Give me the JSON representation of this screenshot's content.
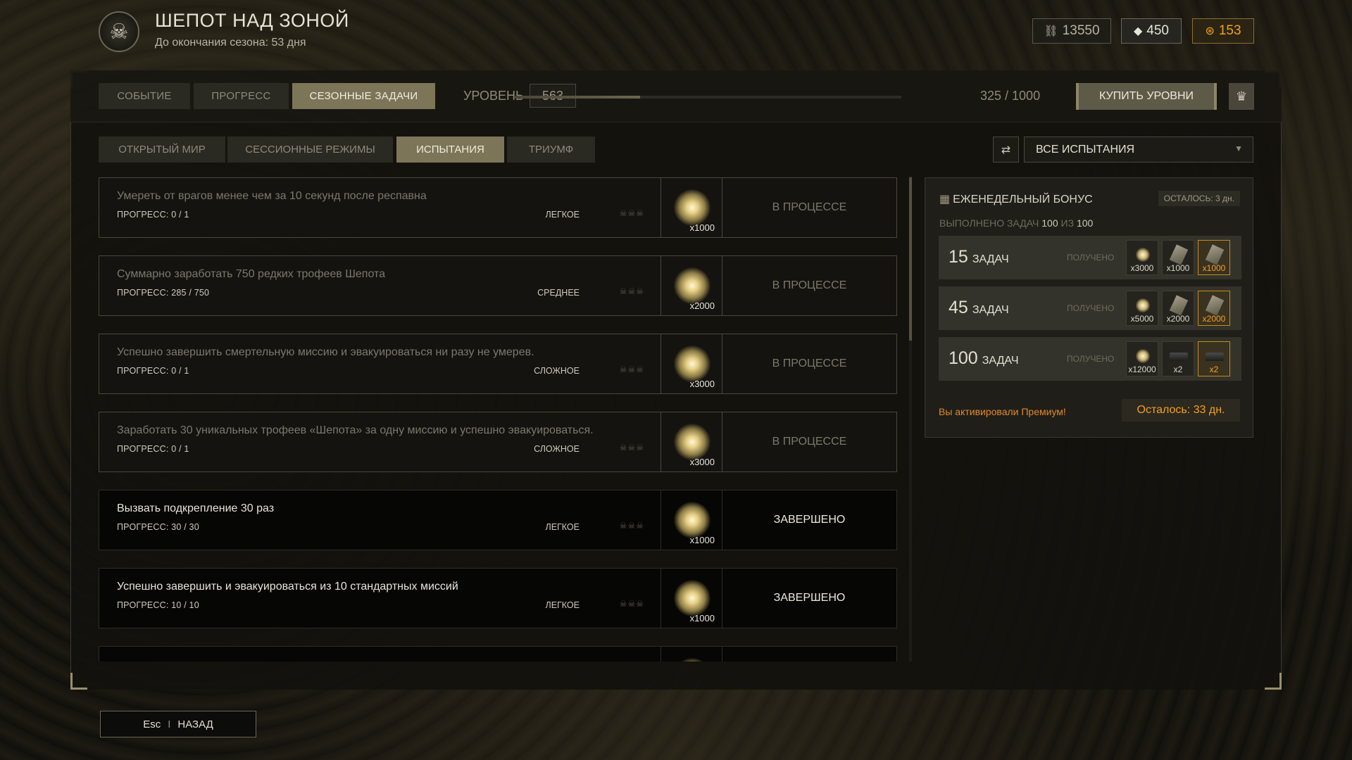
{
  "header": {
    "title": "ШЕПОТ НАД ЗОНОЙ",
    "subtitle": "До окончания сезона: 53 дня",
    "currencies": [
      {
        "icon": "link-icon",
        "value": "13550"
      },
      {
        "icon": "crystal-icon",
        "value": "450"
      },
      {
        "icon": "coin-icon",
        "value": "153"
      }
    ]
  },
  "top_tabs": [
    {
      "label": "СОБЫТИЕ",
      "active": false
    },
    {
      "label": "ПРОГРЕСС",
      "active": false
    },
    {
      "label": "СЕЗОННЫЕ ЗАДАЧИ",
      "active": true
    }
  ],
  "level": {
    "label": "УРОВЕНЬ",
    "value": "563",
    "progress_text": "325 / 1000",
    "progress_fraction": 0.325
  },
  "buy_levels_label": "КУПИТЬ УРОВНИ",
  "sub_tabs": [
    {
      "label": "ОТКРЫТЫЙ МИР",
      "active": false
    },
    {
      "label": "СЕССИОННЫЕ РЕЖИМЫ",
      "active": false
    },
    {
      "label": "ИСПЫТАНИЯ",
      "active": true
    },
    {
      "label": "ТРИУМФ",
      "active": false
    }
  ],
  "filter": {
    "selected": "ВСЕ ИСПЫТАНИЯ"
  },
  "tasks": [
    {
      "name": "Умереть от врагов менее чем за 10 секунд после респавна",
      "progress": "ПРОГРЕСС: 0 / 1",
      "difficulty": "ЛЕГКОЕ",
      "reward": "x1000",
      "status": "В ПРОЦЕССЕ",
      "done": false
    },
    {
      "name": "Суммарно заработать 750 редких трофеев Шепота",
      "progress": "ПРОГРЕСС: 285 / 750",
      "difficulty": "СРЕДНЕЕ",
      "reward": "x2000",
      "status": "В ПРОЦЕССЕ",
      "done": false
    },
    {
      "name": "Успешно завершить смертельную миссию и эвакуироваться ни разу не умерев.",
      "progress": "ПРОГРЕСС: 0 / 1",
      "difficulty": "СЛОЖНОЕ",
      "reward": "x3000",
      "status": "В ПРОЦЕССЕ",
      "done": false
    },
    {
      "name": "Заработать 30 уникальных трофеев «Шепота» за одну миссию и успешно эвакуироваться.",
      "progress": "ПРОГРЕСС: 0 / 1",
      "difficulty": "СЛОЖНОЕ",
      "reward": "x3000",
      "status": "В ПРОЦЕССЕ",
      "done": false
    },
    {
      "name": "Вызвать подкрепление 30 раз",
      "progress": "ПРОГРЕСС: 30 / 30",
      "difficulty": "ЛЕГКОЕ",
      "reward": "x1000",
      "status": "ЗАВЕРШЕНО",
      "done": true
    },
    {
      "name": "Успешно завершить и эвакуироваться из 10 стандартных миссий",
      "progress": "ПРОГРЕСС: 10 / 10",
      "difficulty": "ЛЕГКОЕ",
      "reward": "x1000",
      "status": "ЗАВЕРШЕНО",
      "done": true
    },
    {
      "name": "",
      "progress": "",
      "difficulty": "",
      "reward": "",
      "status": "",
      "done": true
    }
  ],
  "weekly": {
    "title": "ЕЖЕНЕДЕЛЬНЫЙ БОНУС",
    "remaining": "ОСТАЛОСЬ: 3 дн.",
    "completed_prefix": "ВЫПОЛНЕНО ЗАДАЧ",
    "completed_value": "100",
    "completed_mid": "ИЗ",
    "completed_total": "100",
    "tiers": [
      {
        "num": "15",
        "word": "ЗАДАЧ",
        "received": "ПОЛУЧЕНО",
        "items": [
          {
            "type": "orb",
            "label": "x3000",
            "gold": false
          },
          {
            "type": "ticket",
            "label": "x1000",
            "gold": false
          },
          {
            "type": "ticket",
            "label": "x1000",
            "gold": true
          }
        ]
      },
      {
        "num": "45",
        "word": "ЗАДАЧ",
        "received": "ПОЛУЧЕНО",
        "items": [
          {
            "type": "orb",
            "label": "x5000",
            "gold": false
          },
          {
            "type": "ticket",
            "label": "x2000",
            "gold": false
          },
          {
            "type": "ticket",
            "label": "x2000",
            "gold": true
          }
        ]
      },
      {
        "num": "100",
        "word": "ЗАДАЧ",
        "received": "ПОЛУЧЕНО",
        "items": [
          {
            "type": "orb",
            "label": "x12000",
            "gold": false
          },
          {
            "type": "device",
            "label": "x2",
            "gold": false
          },
          {
            "type": "device",
            "label": "x2",
            "gold": true
          }
        ]
      }
    ],
    "premium_text": "Вы активировали Премиум!",
    "premium_remaining": "Осталось: 33 дн."
  },
  "back": {
    "key": "Esc",
    "separator": "I",
    "label": "НАЗАД"
  },
  "colors": {
    "accent": "#7d7558",
    "gold": "#f0a020",
    "premium": "#e08a2a"
  }
}
